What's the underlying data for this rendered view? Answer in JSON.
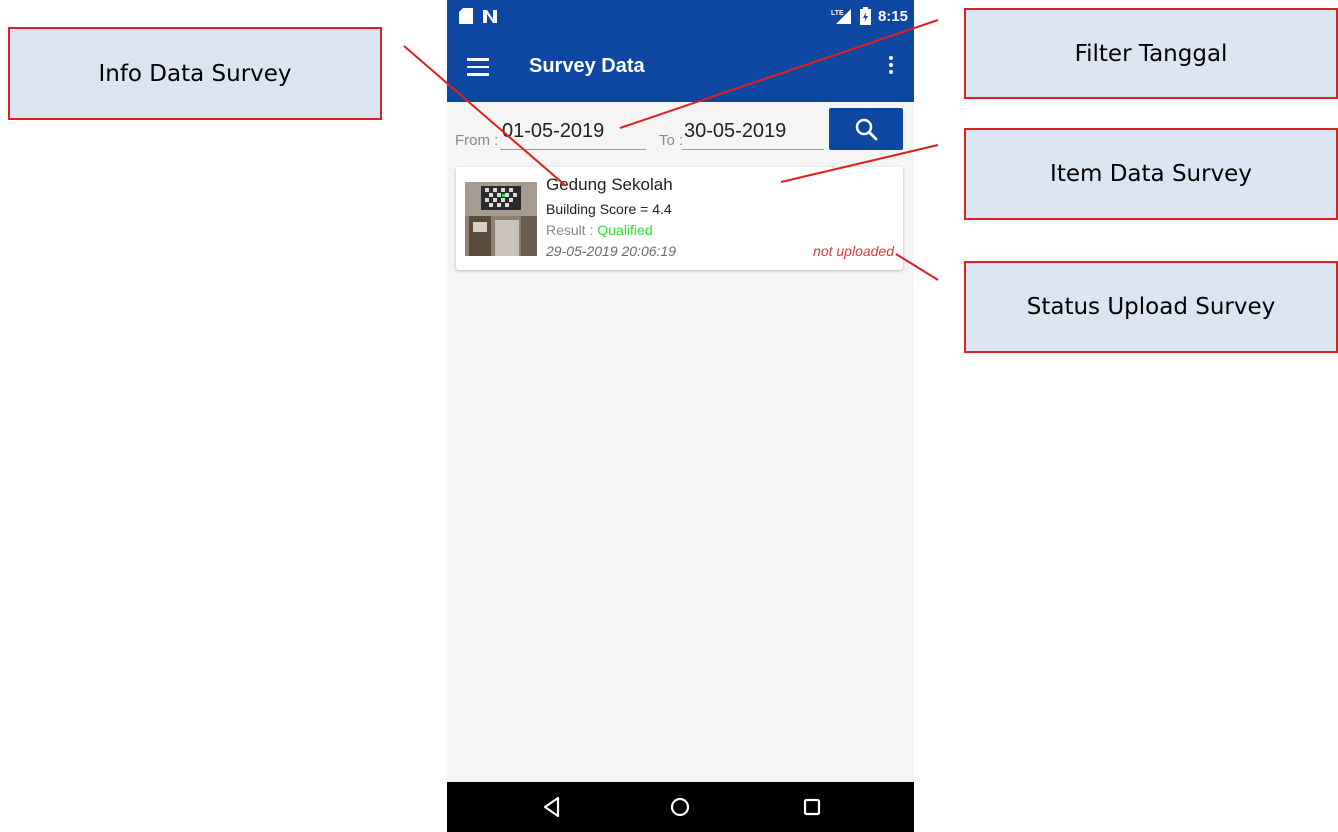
{
  "callouts": {
    "info": "Info Data Survey",
    "filter": "Filter Tanggal",
    "item": "Item Data Survey",
    "status": "Status Upload Survey"
  },
  "status_bar": {
    "time": "8:15",
    "network": "LTE",
    "icons": [
      "sd-card-icon",
      "n-icon",
      "signal-icon",
      "battery-icon"
    ]
  },
  "app_bar": {
    "title": "Survey Data",
    "menu_icon": "hamburger-menu-icon",
    "overflow_icon": "more-vert-icon"
  },
  "filter": {
    "from_label": "From :",
    "from_value": "01-05-2019",
    "to_label": "To :",
    "to_value": "30-05-2019",
    "search_icon": "search-icon"
  },
  "survey_items": [
    {
      "title": "Gedung Sekolah",
      "score_text": "Building Score = 4.4",
      "result_label": "Result :",
      "result_value": "Qualified",
      "datetime": "29-05-2019 20:06:19",
      "upload_status": "not uploaded"
    }
  ],
  "colors": {
    "primary": "#0d47a1",
    "callout_border": "#e0201f",
    "callout_fill": "#dbe5f1",
    "qualified": "#2ee02e",
    "not_uploaded": "#e53935"
  },
  "nav_bar": {
    "icons": [
      "back-icon",
      "home-icon",
      "recents-icon"
    ]
  }
}
